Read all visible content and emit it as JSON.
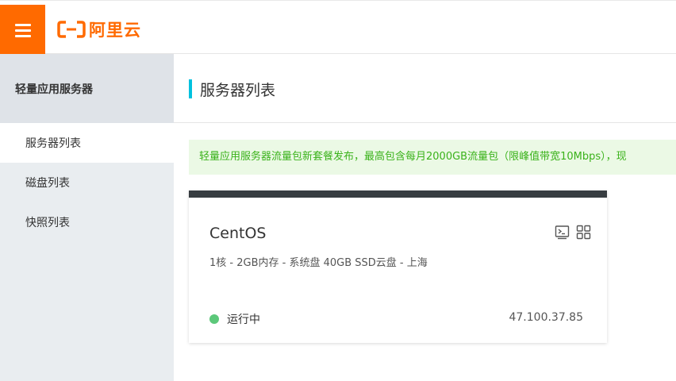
{
  "header": {
    "menu_icon": "hamburger-menu-icon",
    "logo_text": "阿里云",
    "brand_color": "#ff6a00"
  },
  "sidebar": {
    "title": "轻量应用服务器",
    "items": [
      {
        "label": "服务器列表",
        "active": true
      },
      {
        "label": "磁盘列表",
        "active": false
      },
      {
        "label": "快照列表",
        "active": false
      }
    ]
  },
  "main": {
    "title": "服务器列表",
    "notice": "轻量应用服务器流量包新套餐发布，最高包含每月2000GB流量包（限峰值带宽10Mbps），现",
    "server": {
      "os": "CentOS",
      "spec": "1核 - 2GB内存 - 系统盘 40GB SSD云盘 - 上海",
      "status": "运行中",
      "status_color": "#5cc87a",
      "ip": "47.100.37.85",
      "icons": [
        "terminal-icon",
        "grid-apps-icon"
      ]
    }
  }
}
